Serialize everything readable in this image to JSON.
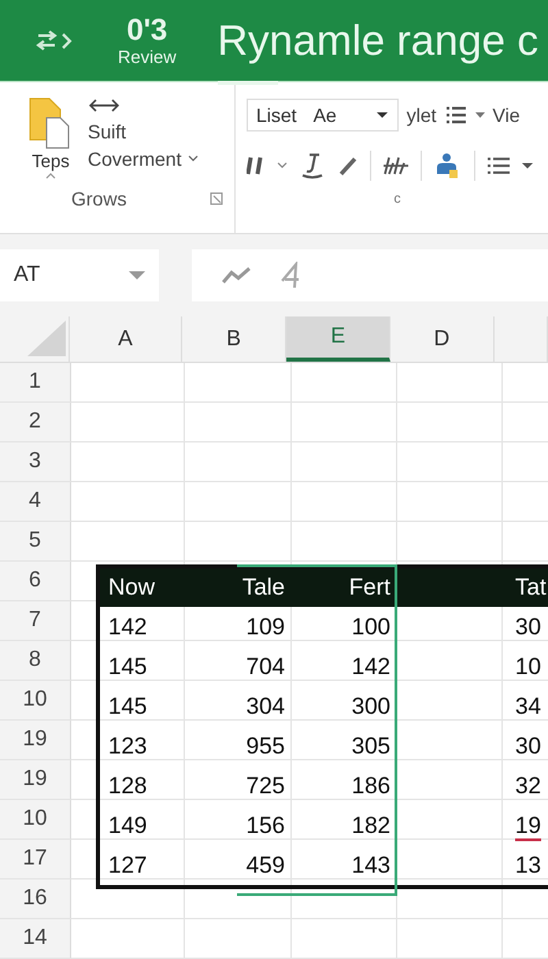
{
  "title_bar": {
    "counter": "0'3",
    "counter_label": "Review",
    "title": "Rynamle range c"
  },
  "ribbon": {
    "paste_label": "Teps",
    "move_label": "Suift",
    "convert_label": "Coverment",
    "group_label": "Grows",
    "font_box": {
      "name": "Liset",
      "size": "Ae"
    },
    "style_label": "ylet",
    "view_label": "Vie",
    "group2_label": "c"
  },
  "formula_bar": {
    "name_box": "AT"
  },
  "columns": [
    {
      "label": "A",
      "selected": false
    },
    {
      "label": "B",
      "selected": false
    },
    {
      "label": "E",
      "selected": true
    },
    {
      "label": "D",
      "selected": false
    },
    {
      "selected": false
    }
  ],
  "row_headers": [
    "1",
    "2",
    "3",
    "4",
    "5",
    "6",
    "7",
    "8",
    "10",
    "19",
    "19",
    "10",
    "17",
    "16",
    "14"
  ],
  "table": {
    "columns": [
      "Now",
      "Tale",
      "Fert",
      "",
      "Tat"
    ],
    "rows": [
      {
        "cells": [
          "142",
          "109",
          "100",
          "",
          "30"
        ],
        "error_underline": false
      },
      {
        "cells": [
          "145",
          "704",
          "142",
          "",
          "10"
        ],
        "error_underline": false
      },
      {
        "cells": [
          "145",
          "304",
          "300",
          "",
          "34"
        ],
        "error_underline": false
      },
      {
        "cells": [
          "123",
          "955",
          "305",
          "",
          "30"
        ],
        "error_underline": false
      },
      {
        "cells": [
          "128",
          "725",
          "186",
          "",
          "32"
        ],
        "error_underline": false
      },
      {
        "cells": [
          "149",
          "156",
          "182",
          "",
          "19"
        ],
        "error_underline": true
      },
      {
        "cells": [
          "127",
          "459",
          "143",
          "",
          "13"
        ],
        "error_underline": false
      }
    ]
  }
}
